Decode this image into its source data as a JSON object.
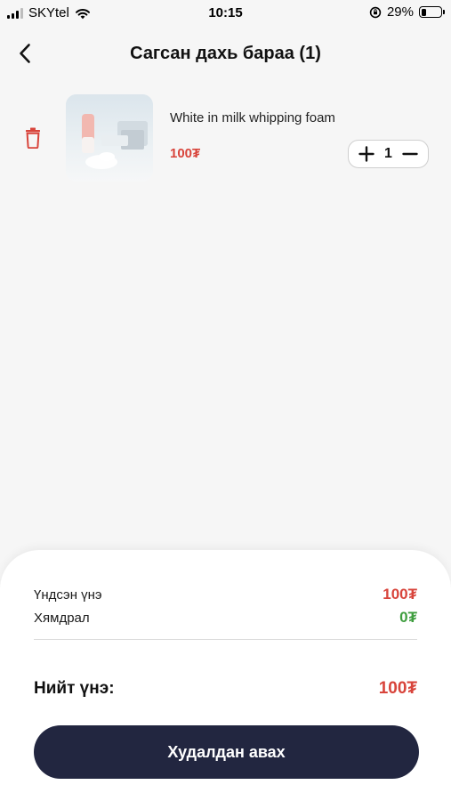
{
  "status_bar": {
    "carrier": "SKYtel",
    "time": "10:15",
    "battery": "29%",
    "battery_level": 0.29
  },
  "header": {
    "title": "Сагсан дахь бараа (1)",
    "back_icon": "chevron-left-icon"
  },
  "cart": {
    "items": [
      {
        "name": "White in milk whipping foam",
        "price": "100₮",
        "quantity": "1"
      }
    ]
  },
  "summary": {
    "base_price_label": "Үндсэн үнэ",
    "base_price_value": "100₮",
    "discount_label": "Хямдрал",
    "discount_value": "0₮",
    "total_label": "Нийт үнэ:",
    "total_value": "100₮"
  },
  "actions": {
    "buy_label": "Худалдан авах"
  },
  "colors": {
    "accent_red": "#d8443b",
    "discount_green": "#3f9e3f",
    "button_dark": "#222640"
  }
}
